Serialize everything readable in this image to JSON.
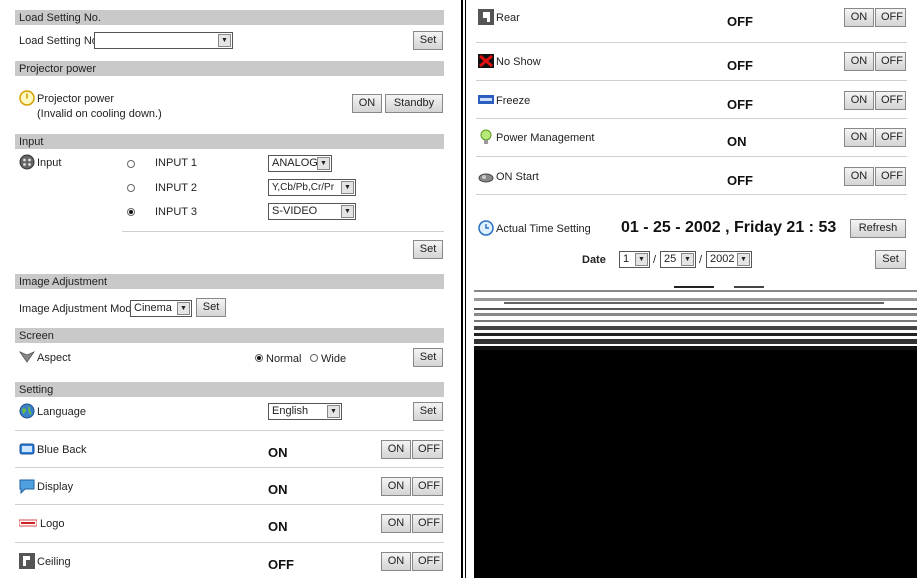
{
  "left": {
    "load": {
      "section": "Load Setting No.",
      "label": "Load Setting No.",
      "value": "",
      "set": "Set"
    },
    "power": {
      "section": "Projector power",
      "label": "Projector power",
      "note": "(Invalid on cooling down.)",
      "on": "ON",
      "standby": "Standby"
    },
    "input": {
      "section": "Input",
      "label": "Input",
      "rows": [
        {
          "name": "INPUT 1",
          "value": "ANALOG",
          "selected": false
        },
        {
          "name": "INPUT 2",
          "value": "Y,Cb/Pb,Cr/Pr",
          "selected": false
        },
        {
          "name": "INPUT 3",
          "value": "S-VIDEO",
          "selected": true
        }
      ],
      "set": "Set"
    },
    "image": {
      "section": "Image Adjustment",
      "label": "Image Adjustment Mode",
      "value": "Cinema",
      "set": "Set"
    },
    "screen": {
      "section": "Screen",
      "label": "Aspect",
      "normal": "Normal",
      "wide": "Wide",
      "set": "Set"
    },
    "setting": {
      "section": "Setting",
      "language": {
        "label": "Language",
        "value": "English",
        "set": "Set"
      },
      "rows": [
        {
          "label": "Blue Back",
          "status": "ON"
        },
        {
          "label": "Display",
          "status": "ON"
        },
        {
          "label": "Logo",
          "status": "ON"
        },
        {
          "label": "Ceiling",
          "status": "OFF"
        }
      ],
      "on": "ON",
      "off": "OFF"
    }
  },
  "right": {
    "rows": [
      {
        "label": "Rear",
        "status": "OFF"
      },
      {
        "label": "No Show",
        "status": "OFF"
      },
      {
        "label": "Freeze",
        "status": "OFF"
      },
      {
        "label": "Power Management",
        "status": "ON"
      },
      {
        "label": "ON Start",
        "status": "OFF"
      }
    ],
    "on": "ON",
    "off": "OFF",
    "time": {
      "label": "Actual Time Setting",
      "value": "01 - 25 - 2002 , Friday 21 : 53",
      "refresh": "Refresh"
    },
    "date": {
      "label": "Date",
      "month": "1",
      "day": "25",
      "year": "2002",
      "sep": "/",
      "set": "Set"
    }
  },
  "icons": {
    "power": "power-icon",
    "input": "input-icon",
    "aspect": "aspect-icon",
    "language": "globe-icon",
    "blue_back": "blue-back-icon",
    "display": "display-icon",
    "logo": "sanyo-logo-icon",
    "ceiling": "ceiling-icon",
    "rear": "rear-icon",
    "no_show": "no-show-icon",
    "freeze": "freeze-icon",
    "power_mgmt": "lightbulb-icon",
    "on_start": "on-start-icon",
    "clock": "clock-icon"
  },
  "colors": {
    "section_bg": "#c9c9c9",
    "button_bg": "#e0e0e0",
    "text": "#222222"
  }
}
